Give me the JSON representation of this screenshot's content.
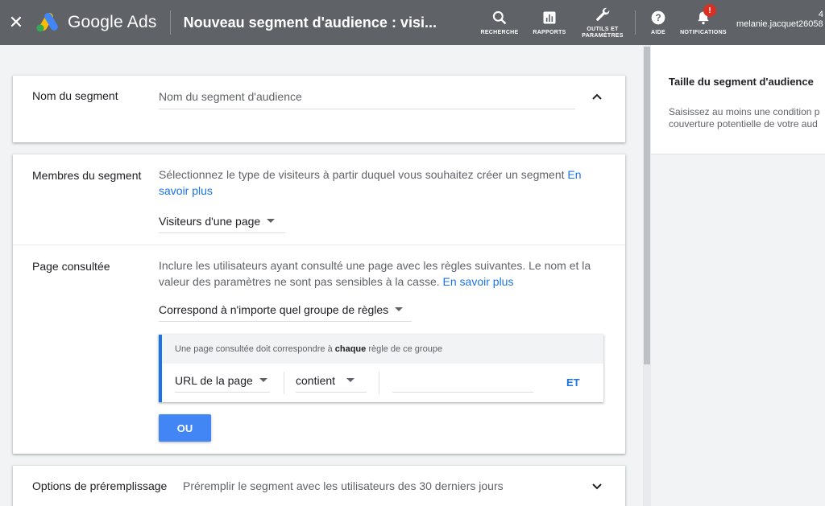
{
  "header": {
    "close_icon": "close-icon",
    "brand": "Google Ads",
    "page_title": "Nouveau segment d'audience : visi...",
    "nav": [
      {
        "id": "search",
        "icon": "search-icon",
        "label": "RECHERCHE"
      },
      {
        "id": "reports",
        "icon": "bar-chart-icon",
        "label": "RAPPORTS"
      },
      {
        "id": "tools",
        "icon": "wrench-icon",
        "label": "OUTILS ET\nPARAMÈTRES"
      },
      {
        "id": "help",
        "icon": "help-icon",
        "label": "AIDE"
      },
      {
        "id": "notifications",
        "icon": "bell-icon",
        "label": "NOTIFICATIONS",
        "badge": "!"
      }
    ],
    "account_number": "4",
    "account_email": "melanie.jacquet26058"
  },
  "segment_name": {
    "label": "Nom du segment",
    "placeholder": "Nom du segment d'audience"
  },
  "segment_members": {
    "label": "Membres du segment",
    "description": "Sélectionnez le type de visiteurs à partir duquel vous souhaitez créer un segment",
    "link_en": "En",
    "link_rest": "savoir plus",
    "visitor_type": "Visiteurs d'une page"
  },
  "page_visited": {
    "label": "Page consultée",
    "description_line1": "Inclure les utilisateurs ayant consulté une page avec les règles suivantes. Le nom et la",
    "description_line2": "valeur des paramètres ne sont pas sensibles à la casse.",
    "link": "En savoir plus",
    "match_mode": "Correspond à n'importe quel groupe de règles",
    "rule_group": {
      "header_pre": "Une page consultée doit correspondre à",
      "header_bold": "chaque",
      "header_post": "règle de ce groupe",
      "field": "URL de la page",
      "operator": "contient",
      "value": "",
      "and_label": "ET"
    },
    "or_label": "OU"
  },
  "prefill": {
    "label": "Options de préremplissage",
    "description": "Préremplir le segment avec les utilisateurs des 30 derniers jours"
  },
  "right_panel": {
    "title": "Taille du segment d'audience",
    "text_line1": "Saisissez au moins une condition p",
    "text_line2": "couverture potentielle de votre aud"
  },
  "colors": {
    "header_bg": "#5f6368",
    "accent": "#1a73e8",
    "button": "#4285f4",
    "badge": "#d93025"
  }
}
